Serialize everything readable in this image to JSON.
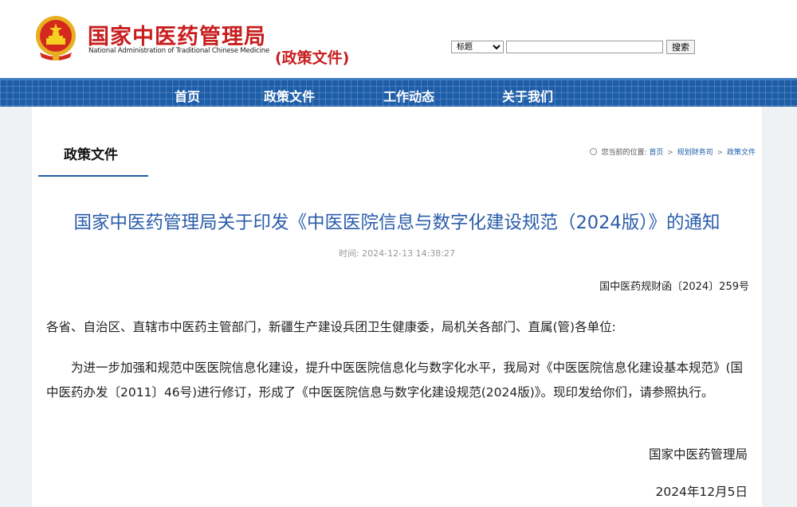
{
  "header": {
    "site_title": "国家中医药管理局",
    "site_subtitle": "National Administration of Traditional Chinese Medicine",
    "section_tag": "(政策文件)",
    "brand_color": "#c81e1e",
    "emblem_icon": "national-emblem"
  },
  "search": {
    "select_value": "标题",
    "button_label": "搜索",
    "input_value": ""
  },
  "nav": {
    "bar_color": "#1e5ea8",
    "items": [
      {
        "label": "首页"
      },
      {
        "label": "政策文件"
      },
      {
        "label": "工作动态"
      },
      {
        "label": "关于我们"
      }
    ]
  },
  "panel": {
    "title": "政策文件",
    "breadcrumb": {
      "icon": "location-icon",
      "prefix": "您当前的位置:",
      "items": [
        "首页",
        "规划财务司",
        "政策文件"
      ],
      "separator": ">"
    }
  },
  "article": {
    "title": "国家中医药管理局关于印发《中医医院信息与数字化建设规范（2024版）》的通知",
    "title_color": "#2a5caa",
    "time": "时间:  2024-12-13 14:38:27",
    "doc_number": "国中医药规财函〔2024〕259号",
    "salutation": "各省、自治区、直辖市中医药主管部门，新疆生产建设兵团卫生健康委，局机关各部门、直属(管)各单位:",
    "body": "为进一步加强和规范中医医院信息化建设，提升中医医院信息化与数字化水平，我局对《中医医院信息化建设基本规范》(国中医药办发〔2011〕46号)进行修订，形成了《中医医院信息与数字化建设规范(2024版)》。现印发给你们，请参照执行。",
    "signature": "国家中医药管理局",
    "date": "2024年12月5日"
  }
}
